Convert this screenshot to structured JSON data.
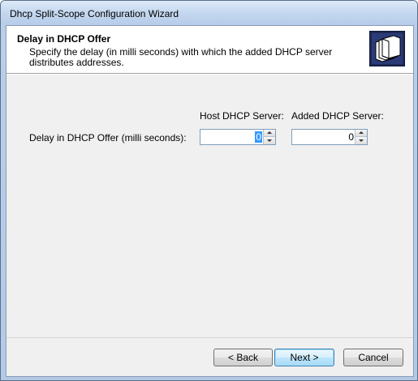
{
  "window": {
    "title": "Dhcp Split-Scope Configuration Wizard"
  },
  "header": {
    "title": "Delay in DHCP Offer",
    "description": "Specify the delay (in milli seconds) with which the added DHCP server distributes addresses.",
    "icon": "folders-icon"
  },
  "form": {
    "host_column_label": "Host DHCP Server:",
    "added_column_label": "Added DHCP Server:",
    "row_label": "Delay in DHCP Offer (milli seconds):",
    "host_delay_value": "0",
    "added_delay_value": "0"
  },
  "buttons": {
    "back": "< Back",
    "next": "Next >",
    "cancel": "Cancel"
  }
}
